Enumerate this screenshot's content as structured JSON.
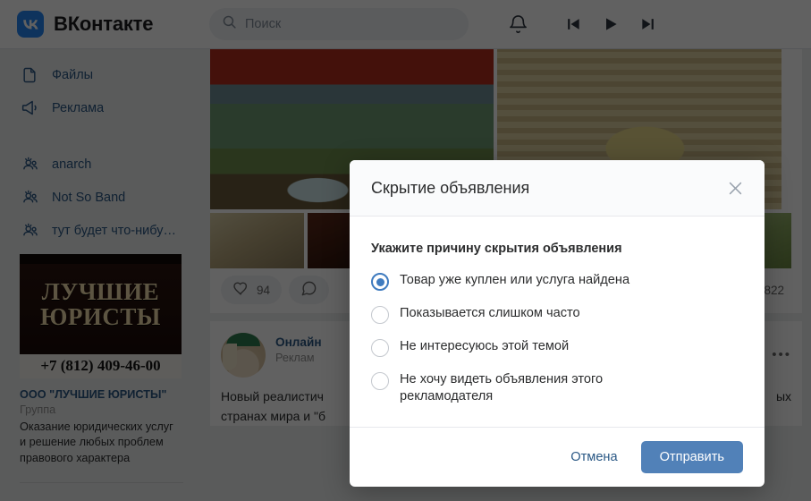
{
  "header": {
    "brand": "ВКонтакте",
    "logo_icon": "vk-logo-icon",
    "search": {
      "placeholder": "Поиск",
      "value": "",
      "icon": "search-icon"
    },
    "notifications_icon": "bell-icon",
    "player": {
      "prev_icon": "skip-previous-icon",
      "play_icon": "play-icon",
      "next_icon": "skip-next-icon"
    }
  },
  "sidebar": {
    "items": [
      {
        "label": "Файлы",
        "icon": "file-icon"
      },
      {
        "label": "Реклама",
        "icon": "megaphone-icon"
      }
    ],
    "groups": [
      {
        "label": "anarch",
        "icon": "people-icon"
      },
      {
        "label": "Not So Band",
        "icon": "people-icon"
      },
      {
        "label": "тут будет что-нибу…",
        "icon": "people-icon"
      }
    ],
    "ad": {
      "banner_line1": "ЛУЧШИЕ",
      "banner_line2": "ЮРИСТЫ",
      "banner_phone": "+7 (812) 409-46-00",
      "title": "ООО \"ЛУЧШИЕ ЮРИСТЫ\"",
      "subtitle": "Группа",
      "body": "Оказание юридических услуг и решение любых проблем правового характера"
    }
  },
  "feed": {
    "photo_post": {
      "likes": "94",
      "like_icon": "heart-icon",
      "comment_icon": "comment-icon",
      "views": "822"
    },
    "ad_post": {
      "author": "Онлайн",
      "subtitle": "Реклам",
      "more_icon": "more-horizontal-icon",
      "text_line1": "Новый реалистич",
      "text_line1_tail": "ых",
      "text_line2": "странах мира и \"б"
    }
  },
  "modal": {
    "title": "Скрытие объявления",
    "close_icon": "close-icon",
    "reason_label": "Укажите причину скрытия объявления",
    "options": [
      {
        "label": "Товар уже куплен или услуга найдена",
        "selected": true
      },
      {
        "label": "Показывается слишком часто",
        "selected": false
      },
      {
        "label": "Не интересуюсь этой темой",
        "selected": false
      },
      {
        "label": "Не хочу видеть объявления этого рекламодателя",
        "selected": false
      }
    ],
    "cancel_label": "Отмена",
    "submit_label": "Отправить"
  },
  "colors": {
    "vk_blue": "#2787f5",
    "link_blue": "#2a5885",
    "submit_blue": "#5181b8",
    "radio_blue": "#3f7bbf",
    "page_bg": "#edeef0"
  }
}
